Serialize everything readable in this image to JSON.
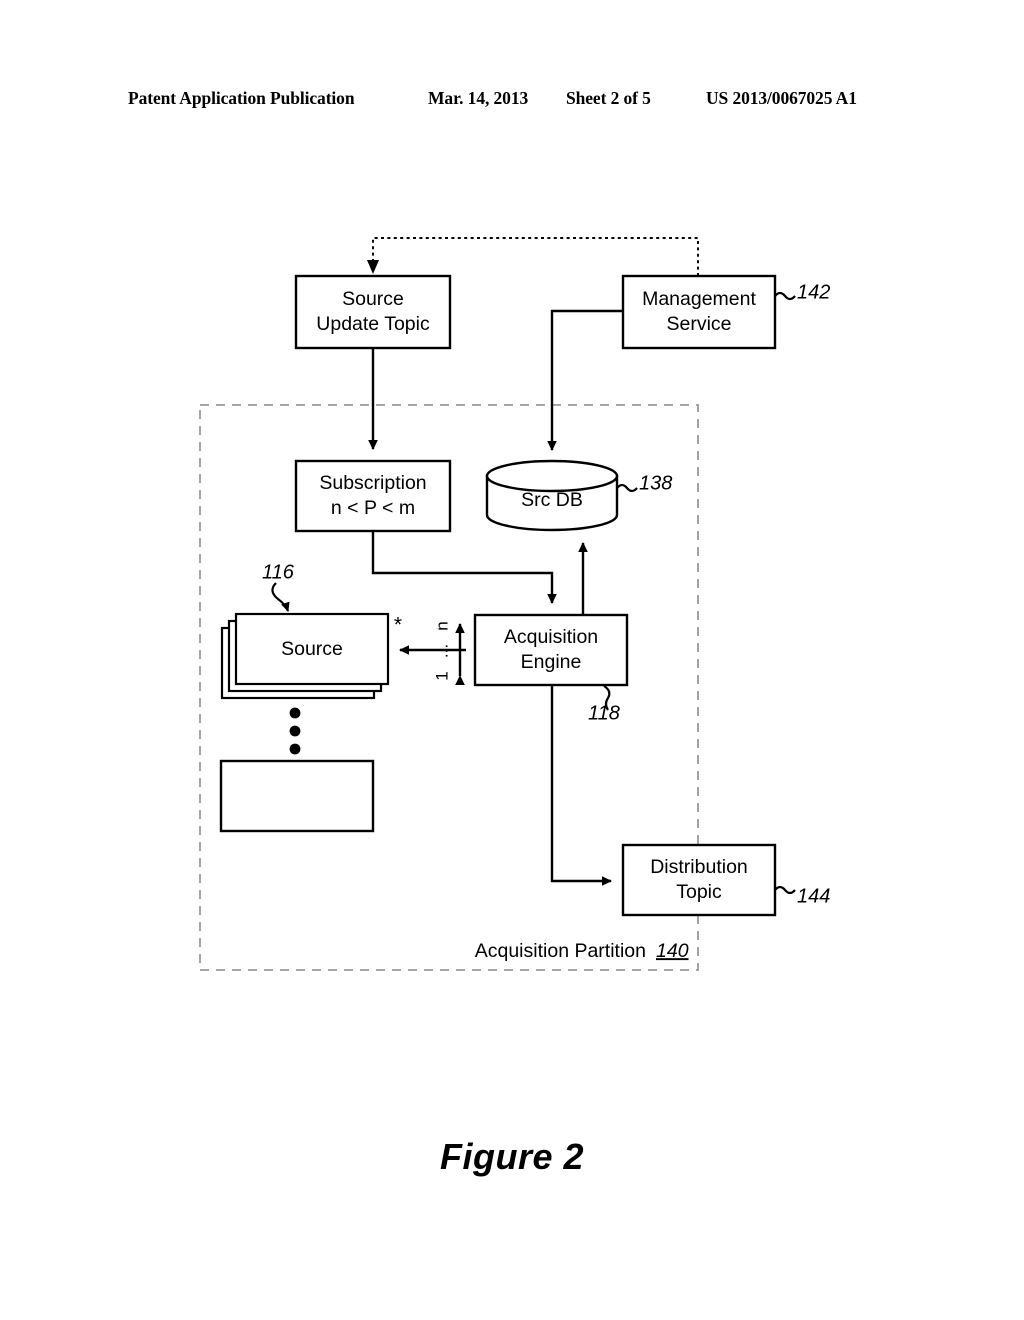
{
  "header": {
    "publication": "Patent Application Publication",
    "date": "Mar. 14, 2013",
    "sheet": "Sheet 2 of 5",
    "number": "US 2013/0067025 A1"
  },
  "figure": {
    "caption": "Figure 2"
  },
  "diagram": {
    "nodes": {
      "source_update_topic": {
        "label_line1": "Source",
        "label_line2": "Update Topic"
      },
      "management_service": {
        "label_line1": "Management",
        "label_line2": "Service",
        "ref": "142"
      },
      "subscription": {
        "label_line1": "Subscription",
        "label_line2": "n < P < m"
      },
      "src_db": {
        "label": "Src DB",
        "ref": "138"
      },
      "source": {
        "label": "Source",
        "ref": "116",
        "multiplicity": "*"
      },
      "acquisition_engine": {
        "label_line1": "Acquisition",
        "label_line2": "Engine",
        "ref": "118"
      },
      "distribution_topic": {
        "label_line1": "Distribution",
        "label_line2": "Topic",
        "ref": "144"
      },
      "empty_source": {
        "label": ""
      }
    },
    "edges": {
      "source_multiplicity_low": "1",
      "source_multiplicity_ellipsis": "...",
      "source_multiplicity_high": "n"
    },
    "partition": {
      "label": "Acquisition Partition",
      "ref": "140"
    }
  }
}
